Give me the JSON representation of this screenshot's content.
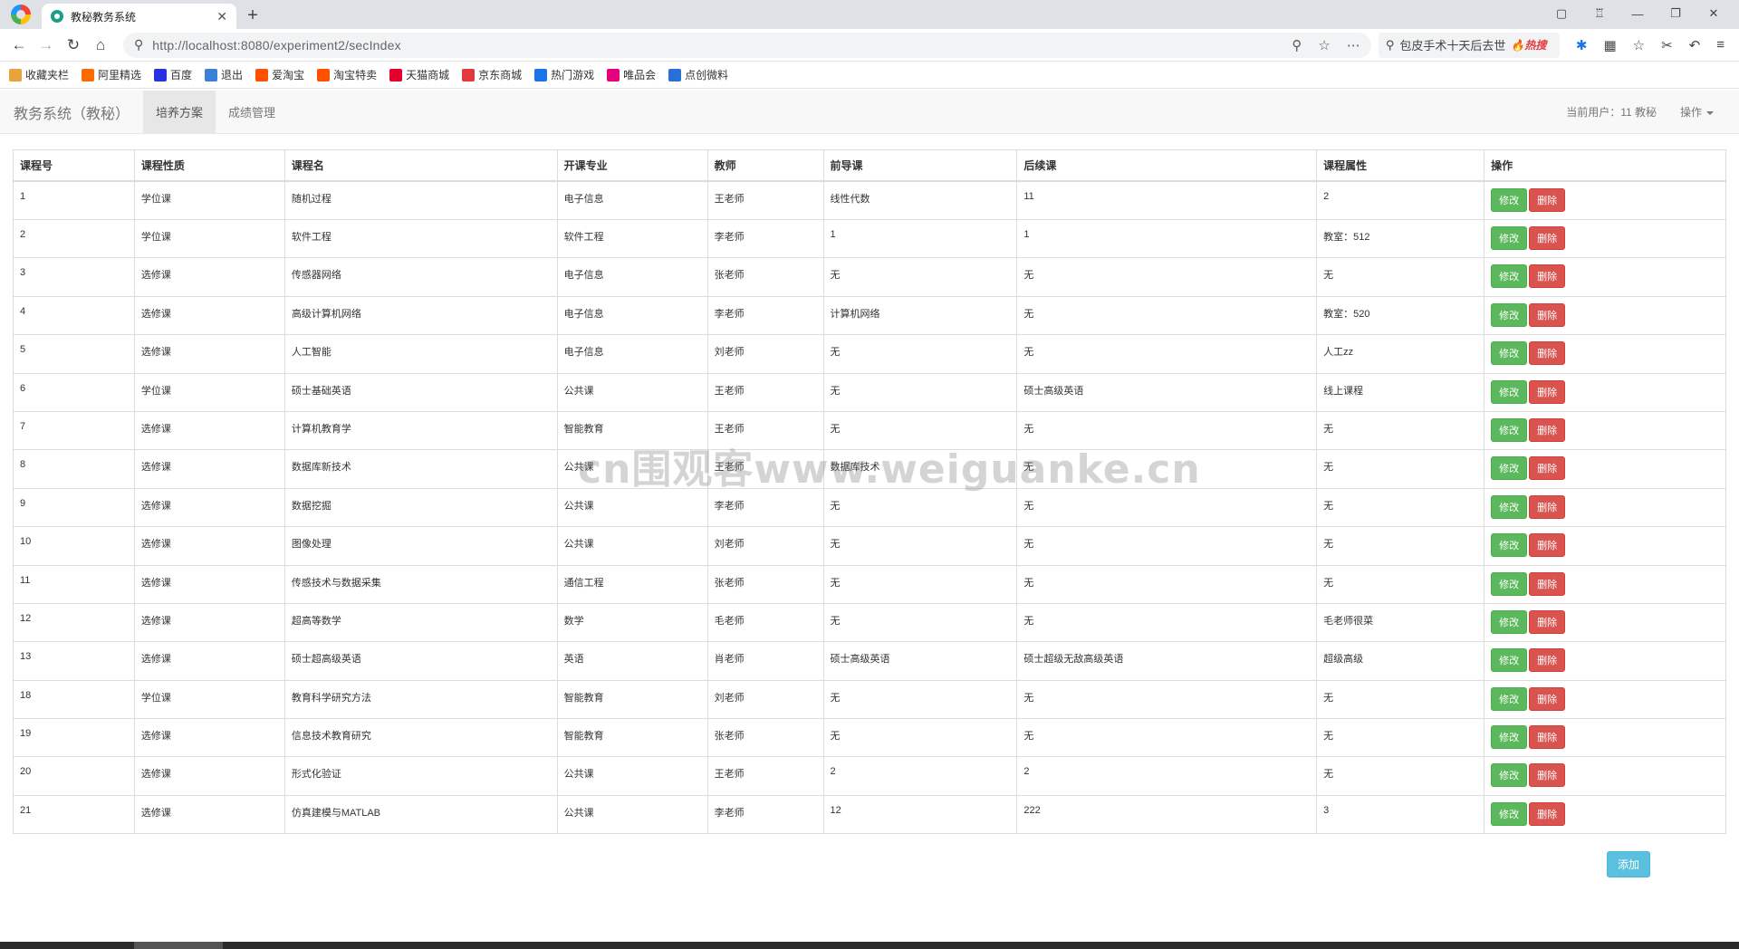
{
  "browser": {
    "tab_title": "教秘教务系统",
    "tab_close": "✕",
    "new_tab": "+",
    "url": "http://localhost:8080/experiment2/secIndex",
    "hot_search_text": "包皮手术十天后去世",
    "hot_badge": "🔥热搜",
    "bookmarks": [
      "收藏夹栏",
      "阿里精选",
      "百度",
      "退出",
      "爱淘宝",
      "淘宝特卖",
      "天猫商城",
      "京东商城",
      "热门游戏",
      "唯品会",
      "点创微料"
    ],
    "bookmark_colors": [
      "#e8a33d",
      "#ff6a00",
      "#2932e1",
      "#3b7fd6",
      "#ff5000",
      "#ff5000",
      "#e4002b",
      "#e4393c",
      "#1a73e8",
      "#e6007e",
      "#2a6fd6"
    ]
  },
  "app": {
    "brand": "教务系统（教秘）",
    "nav": [
      "培养方案",
      "成绩管理"
    ],
    "current_user": "当前用户：11 教秘",
    "operation_menu": "操作"
  },
  "table": {
    "headers": [
      "课程号",
      "课程性质",
      "课程名",
      "开课专业",
      "教师",
      "前导课",
      "后续课",
      "课程属性",
      "操作"
    ],
    "edit_label": "修改",
    "delete_label": "删除",
    "rows": [
      [
        "1",
        "学位课",
        "随机过程",
        "电子信息",
        "王老师",
        "线性代数",
        "11",
        "2"
      ],
      [
        "2",
        "学位课",
        "软件工程",
        "软件工程",
        "李老师",
        "1",
        "1",
        "教室：512"
      ],
      [
        "3",
        "选修课",
        "传感器网络",
        "电子信息",
        "张老师",
        "无",
        "无",
        "无"
      ],
      [
        "4",
        "选修课",
        "高级计算机网络",
        "电子信息",
        "李老师",
        "计算机网络",
        "无",
        "教室：520"
      ],
      [
        "5",
        "选修课",
        "人工智能",
        "电子信息",
        "刘老师",
        "无",
        "无",
        "人工zz"
      ],
      [
        "6",
        "学位课",
        "硕士基础英语",
        "公共课",
        "王老师",
        "无",
        "硕士高级英语",
        "线上课程"
      ],
      [
        "7",
        "选修课",
        "计算机教育学",
        "智能教育",
        "王老师",
        "无",
        "无",
        "无"
      ],
      [
        "8",
        "选修课",
        "数据库新技术",
        "公共课",
        "王老师",
        "数据库技术",
        "无",
        "无"
      ],
      [
        "9",
        "选修课",
        "数据挖掘",
        "公共课",
        "李老师",
        "无",
        "无",
        "无"
      ],
      [
        "10",
        "选修课",
        "图像处理",
        "公共课",
        "刘老师",
        "无",
        "无",
        "无"
      ],
      [
        "11",
        "选修课",
        "传感技术与数据采集",
        "通信工程",
        "张老师",
        "无",
        "无",
        "无"
      ],
      [
        "12",
        "选修课",
        "超高等数学",
        "数学",
        "毛老师",
        "无",
        "无",
        "毛老师很菜"
      ],
      [
        "13",
        "选修课",
        "硕士超高级英语",
        "英语",
        "肖老师",
        "硕士高级英语",
        "硕士超级无敌高级英语",
        "超级高级"
      ],
      [
        "18",
        "学位课",
        "教育科学研究方法",
        "智能教育",
        "刘老师",
        "无",
        "无",
        "无"
      ],
      [
        "19",
        "选修课",
        "信息技术教育研究",
        "智能教育",
        "张老师",
        "无",
        "无",
        "无"
      ],
      [
        "20",
        "选修课",
        "形式化验证",
        "公共课",
        "王老师",
        "2",
        "2",
        "无"
      ],
      [
        "21",
        "选修课",
        "仿真建模与MATLAB",
        "公共课",
        "李老师",
        "12",
        "222",
        "3"
      ]
    ]
  },
  "add_button": "添加",
  "watermark": "cn围观客www.weiguanke.cn"
}
